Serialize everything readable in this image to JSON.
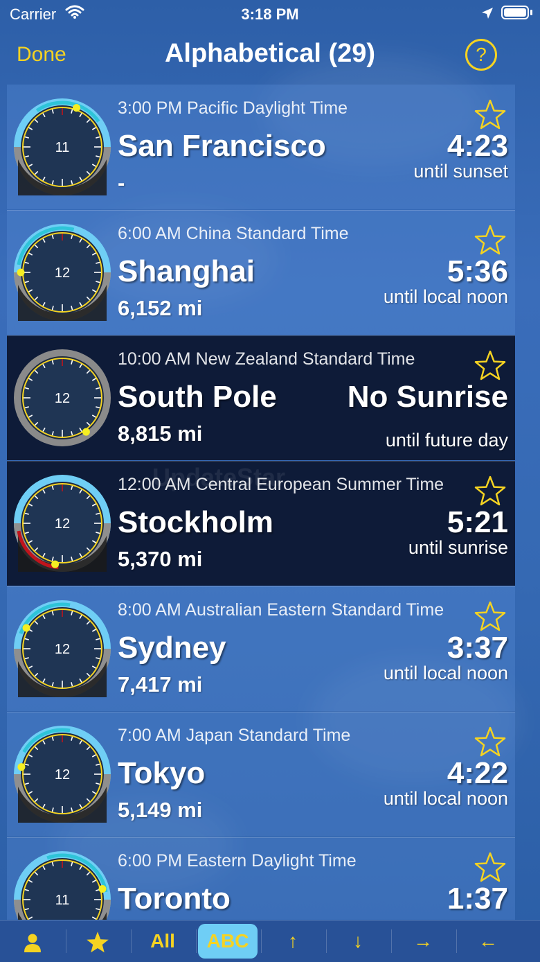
{
  "status_bar": {
    "carrier": "Carrier",
    "time": "3:18 PM"
  },
  "nav": {
    "done_label": "Done",
    "title": "Alphabetical (29)",
    "help_label": "?"
  },
  "colors": {
    "accent": "#f5d322",
    "dial_ring": "#6fcef5",
    "row_dark": "#0e1b38",
    "active_tab": "#6fcef5"
  },
  "rows": [
    {
      "timezone": "3:00 PM Pacific Daylight Time",
      "city": "San Francisco",
      "distance": "-",
      "countdown": "4:23",
      "until": "until sunset",
      "dial_label": "11",
      "dark": false
    },
    {
      "timezone": "6:00 AM China Standard Time",
      "city": "Shanghai",
      "distance": "6,152 mi",
      "countdown": "5:36",
      "until": "until local noon",
      "dial_label": "12",
      "dark": false
    },
    {
      "timezone": "10:00 AM New Zealand Standard Time",
      "city": "South Pole",
      "distance": "8,815 mi",
      "countdown": "No Sunrise",
      "until": "until future day",
      "dial_label": "12",
      "dark": true
    },
    {
      "timezone": "12:00 AM Central European Summer Time",
      "city": "Stockholm",
      "distance": "5,370 mi",
      "countdown": "5:21",
      "until": "until sunrise",
      "dial_label": "12",
      "dark": true
    },
    {
      "timezone": "8:00 AM Australian Eastern Standard Time",
      "city": "Sydney",
      "distance": "7,417 mi",
      "countdown": "3:37",
      "until": "until local noon",
      "dial_label": "12",
      "dark": false
    },
    {
      "timezone": "7:00 AM Japan Standard Time",
      "city": "Tokyo",
      "distance": "5,149 mi",
      "countdown": "4:22",
      "until": "until local noon",
      "dial_label": "12",
      "dark": false
    },
    {
      "timezone": "6:00 PM Eastern Daylight Time",
      "city": "Toronto",
      "distance": "",
      "countdown": "1:37",
      "until": "",
      "dial_label": "11",
      "dark": false
    }
  ],
  "toolbar": {
    "items": [
      {
        "label": "",
        "icon": "person-icon"
      },
      {
        "label": "",
        "icon": "star-icon"
      },
      {
        "label": "All",
        "icon": ""
      },
      {
        "label": "ABC",
        "icon": ""
      },
      {
        "label": "↑",
        "icon": "arrow-up-icon"
      },
      {
        "label": "↓",
        "icon": "arrow-down-icon"
      },
      {
        "label": "→",
        "icon": "arrow-right-icon"
      },
      {
        "label": "←",
        "icon": "arrow-left-icon"
      }
    ],
    "active_index": 3
  }
}
